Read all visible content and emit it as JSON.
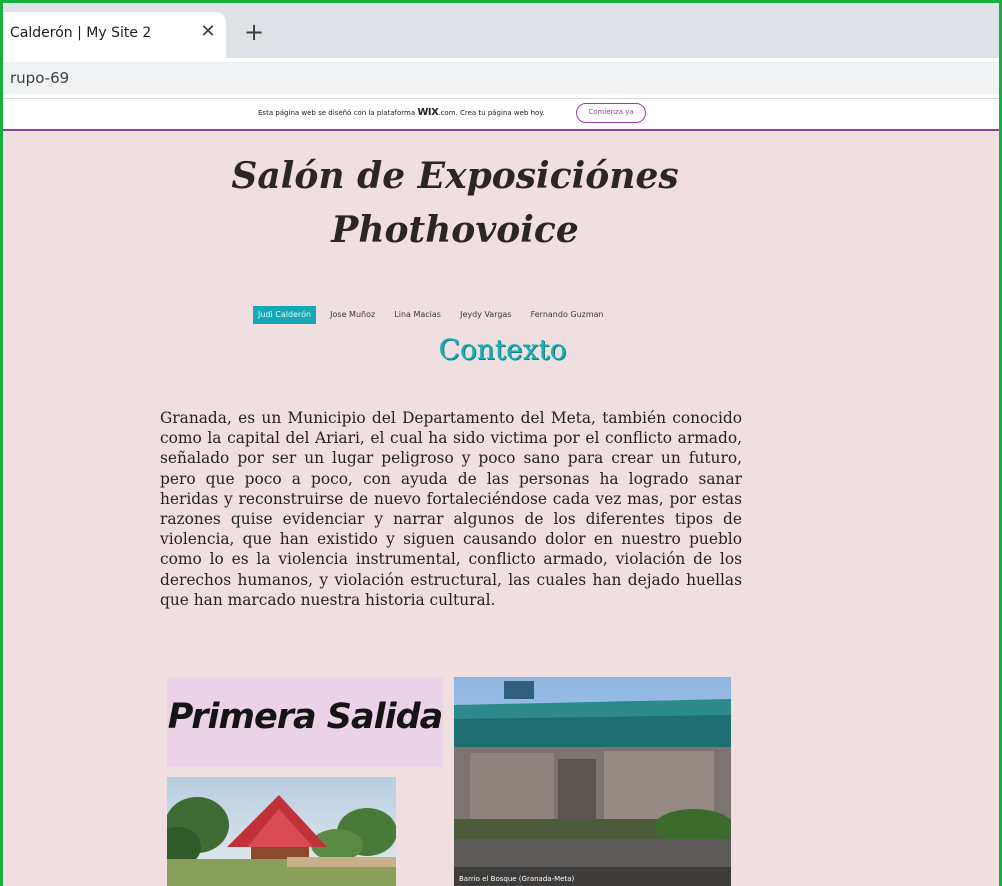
{
  "browser": {
    "tab_title": "Calderón | My Site 2",
    "close_glyph": "✕",
    "newtab_glyph": "+",
    "url": "rupo-69"
  },
  "wix_banner": {
    "text_before": "Esta página web se diseñó con la plataforma ",
    "logo": "WIX",
    "logo_suffix": ".com",
    "text_after": ". Crea tu página web hoy.",
    "cta": "Comienza ya"
  },
  "site": {
    "title_line1": "Salón de Exposiciónes",
    "title_line2": "Phothovoice"
  },
  "nav": {
    "items": [
      {
        "label": "Judi Calderón"
      },
      {
        "label": "Jose Muñoz"
      },
      {
        "label": "Lina Macias"
      },
      {
        "label": "Jeydy Vargas"
      },
      {
        "label": "Fernando Guzman"
      }
    ],
    "active_color": "#17a8b5"
  },
  "content": {
    "section_title": "Contexto",
    "paragraph": "Granada, es un Municipio del Departamento del Meta, también conocido como la capital del Ariari, el cual ha sido victima por el conflicto armado, señalado por ser un lugar peligroso y poco sano para crear un futuro, pero que poco a poco, con ayuda de las personas ha logrado sanar heridas y reconstruirse de nuevo fortaleciéndose cada vez mas, por estas razones quise evidenciar y narrar algunos de los diferentes tipos de violencia, que han existido y siguen causando dolor en nuestro pueblo como lo es la violencia instrumental, conflicto armado, violación de los derechos humanos, y violación estructural, las cuales han dejado huellas que han marcado nuestra historia cultural.",
    "salida_label": "Primera Salida",
    "photo_caption": "Barrio el Bosque (Granada-Meta)"
  },
  "colors": {
    "page_bg": "#efdfe0",
    "accent_teal": "#19b0b4",
    "wix_purple": "#9b3ea8",
    "salida_bg": "#ebd2e6",
    "frame_green": "#18b03c"
  }
}
